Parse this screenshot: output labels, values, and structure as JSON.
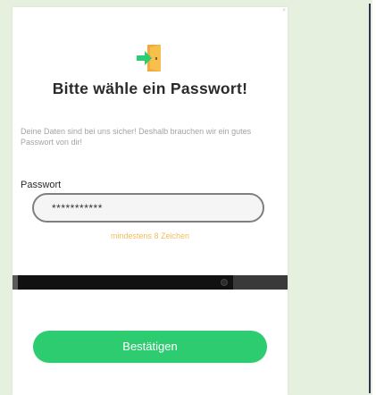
{
  "dialog": {
    "close_label": "×",
    "title": "Bitte wähle ein Passwort!",
    "description": "Deine Daten sind bei uns sicher! Deshalb brauchen wir ein gutes Passwort von dir!",
    "password_label": "Passwort",
    "password_value": "***********",
    "hint": "mindestens 8 Zeichen",
    "confirm_label": "Bestätigen",
    "icon": "door-enter-icon"
  },
  "colors": {
    "accent_green": "#2ecc71",
    "hint_orange": "#f3bd58",
    "page_bg": "#e6f0df"
  }
}
